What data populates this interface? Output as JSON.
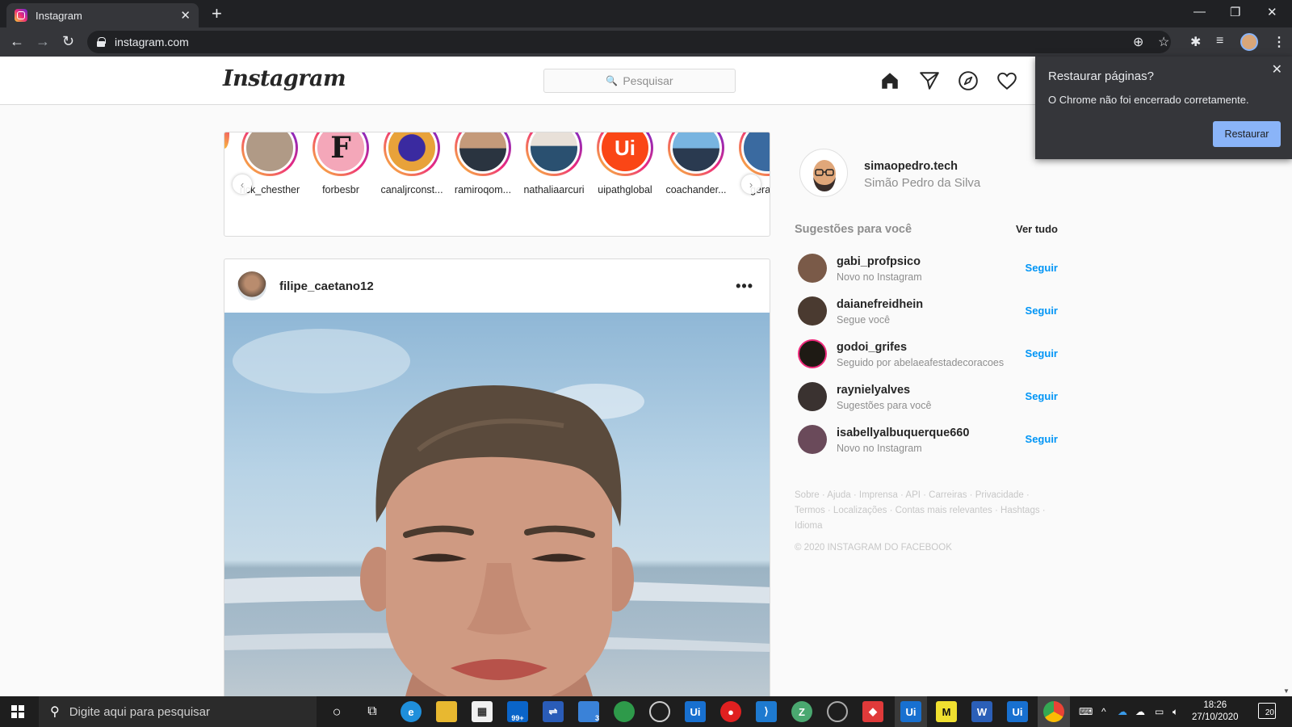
{
  "browser": {
    "tab_title": "Instagram",
    "url": "instagram.com",
    "new_tab": "+",
    "tab_close": "✕"
  },
  "restore_popup": {
    "title": "Restaurar páginas?",
    "message": "O Chrome não foi encerrado corretamente.",
    "button": "Restaurar"
  },
  "instagram": {
    "logo": "Instagram",
    "search_placeholder": "Pesquisar",
    "stories": [
      {
        "name": "rick_chesther",
        "color": "#b09a86"
      },
      {
        "name": "forbesbr",
        "color": "#f4a7b9"
      },
      {
        "name": "canaljrconst...",
        "color": "#e8a23a"
      },
      {
        "name": "ramiroqom...",
        "color": "#6a7b8c"
      },
      {
        "name": "nathaliaarcuri",
        "color": "#d0b8a8"
      },
      {
        "name": "uipathglobal",
        "color": "#fa4616"
      },
      {
        "name": "coachander...",
        "color": "#5a8ab8"
      },
      {
        "name": "geraldo",
        "color": "#3a6aa0"
      }
    ],
    "post": {
      "username": "filipe_caetano12",
      "more": "•••"
    },
    "sidebar": {
      "username": "simaopedro.tech",
      "fullname": "Simão Pedro da Silva",
      "suggestions_title": "Sugestões para você",
      "see_all": "Ver tudo",
      "suggestions": [
        {
          "user": "gabi_profpsico",
          "sub": "Novo no Instagram",
          "action": "Seguir",
          "color": "#7a5a48"
        },
        {
          "user": "daianefreidhein",
          "sub": "Segue você",
          "action": "Seguir",
          "color": "#4a3a30"
        },
        {
          "user": "godoi_grifes",
          "sub": "Seguido por abelaeafestadecoracoes",
          "action": "Seguir",
          "color": "#1e1a14"
        },
        {
          "user": "raynielyalves",
          "sub": "Sugestões para você",
          "action": "Seguir",
          "color": "#3a3230"
        },
        {
          "user": "isabellyalbuquerque660",
          "sub": "Novo no Instagram",
          "action": "Seguir",
          "color": "#6a4a5a"
        }
      ],
      "footer_links": "Sobre · Ajuda · Imprensa · API · Carreiras · Privacidade · Termos · Localizações · Contas mais relevantes · Hashtags · Idioma",
      "copyright": "© 2020 INSTAGRAM DO FACEBOOK"
    }
  },
  "taskbar": {
    "search_placeholder": "Digite aqui para pesquisar",
    "time": "18:26",
    "date": "27/10/2020",
    "notifications": "20",
    "mail_badge": "99+",
    "todo_badge": "3"
  },
  "colors": {
    "instagram_blue": "#0095f6",
    "chrome_dark": "#202124",
    "chrome_toolbar": "#35363a",
    "restore_button": "#8ab4f8"
  }
}
